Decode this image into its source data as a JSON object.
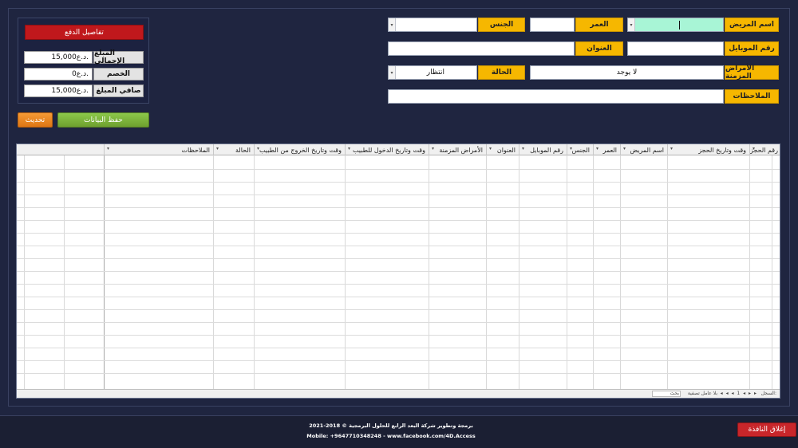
{
  "form": {
    "patient_name": {
      "label": "اسم المريض",
      "value": ""
    },
    "age": {
      "label": "العمر",
      "value": ""
    },
    "gender": {
      "label": "الجنس",
      "value": ""
    },
    "mobile": {
      "label": "رقم الموبايل",
      "value": ""
    },
    "address": {
      "label": "العنوان",
      "value": ""
    },
    "chronic": {
      "label": "الأمراض المزمنة",
      "value": "لا يوجد"
    },
    "status": {
      "label": "الحالة",
      "value": "انتظار"
    },
    "notes": {
      "label": "الملاحظات",
      "value": ""
    }
  },
  "payment": {
    "title": "تفاصيل الدفع",
    "total": {
      "label": "المبلغ الإجمالي",
      "value": "15,000د.ع."
    },
    "discount": {
      "label": "الخصم",
      "value": "0د.ع."
    },
    "net": {
      "label": "صافي المبلغ",
      "value": "15,000د.ع."
    }
  },
  "buttons": {
    "save": "حفظ البيانات",
    "refresh": "تحديث",
    "close": "إغلاق النافذة"
  },
  "grid": {
    "columns": [
      "رقم الحجز",
      "وقت وتاريخ الحجز",
      "اسم المريض",
      "العمر",
      "الجنس",
      "رقم الموبايل",
      "العنوان",
      "الأمراض المزمنة",
      "وقت وتاريخ الدخول للطبيب",
      "وقت وتاريخ الخروج من الطبيب",
      "الحالة",
      "الملاحظات"
    ],
    "status_bar": {
      "record_label": "السجل:",
      "nav": "◂ ◂ ◂ 1 ◂ ▸ ▸",
      "filter": "بلا عامل تصفية",
      "search": "بحث"
    }
  },
  "footer": {
    "line1": "برمجة وتطوير شركة البعد الرابع للحلول البرمجية © 2018-2021",
    "line2": "Mobile: +9647710348248 - www.facebook.com/4D.Access"
  },
  "colors": {
    "background": "#1f2540",
    "label_yellow": "#f6b700",
    "title_red": "#c0181c",
    "save_green": "#7bb03a",
    "refresh_orange": "#ef8a22",
    "close_red": "#c8262a",
    "active_input": "#a8f5d6"
  }
}
